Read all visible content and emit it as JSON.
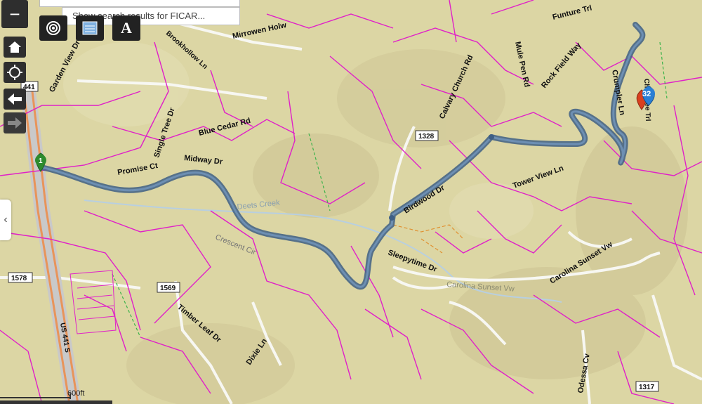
{
  "search": {
    "placeholder_result": "Show search results for FICAR..."
  },
  "controls": {
    "zoom_out_symbol": "−",
    "home_icon": "home-icon",
    "locate_icon": "locate-icon",
    "back_icon": "arrow-left-icon",
    "forward_icon": "arrow-right-icon",
    "collapse_icon": "chevron-left-icon"
  },
  "toolbar": {
    "tools": [
      {
        "icon": "target-icon"
      },
      {
        "icon": "legend-icon"
      },
      {
        "icon": "label-icon",
        "text": "A"
      }
    ]
  },
  "markers": {
    "start_label": "1",
    "end_label": "32",
    "start_color": "#2e8b2e",
    "end_color": "#2a7fd4",
    "pin_color": "#d9401e"
  },
  "route": {
    "color": "#4a6f96"
  },
  "scale": {
    "label": "600ft"
  },
  "map_labels": [
    {
      "text": "Mirrowen Holw"
    },
    {
      "text": "Garden View Dr"
    },
    {
      "text": "Single Tree Dr"
    },
    {
      "text": "Blue Cedar Rd"
    },
    {
      "text": "Promise Ct"
    },
    {
      "text": "Midway Dr"
    },
    {
      "text": "Calvary Church Rd"
    },
    {
      "text": "Mule Pen Rd"
    },
    {
      "text": "Rock Field Way"
    },
    {
      "text": "Crumpler Ln"
    },
    {
      "text": "Tower View Ln"
    },
    {
      "text": "Birdwood Dr"
    },
    {
      "text": "Sleepytime Dr"
    },
    {
      "text": "Carolina Sunset Vw"
    },
    {
      "text": "Timber Leaf Dr"
    },
    {
      "text": "Dixie Ln"
    },
    {
      "text": "Odessa Cv"
    },
    {
      "text": "US 441 S"
    },
    {
      "text": "Deets Creek"
    },
    {
      "text": "Carolina Sunset Vw"
    },
    {
      "text": "Cherokee Trl"
    },
    {
      "text": "Funture Trl"
    },
    {
      "text": "Brookhollow Ln"
    },
    {
      "text": "Crescent Cir"
    }
  ],
  "road_shields": [
    "1578",
    "1569",
    "1328",
    "1317",
    "441"
  ],
  "colors": {
    "parcel": "#e020c8",
    "terrain": "#dcd8a8",
    "road": "#f5f5f5",
    "highway": "#e8945a"
  }
}
